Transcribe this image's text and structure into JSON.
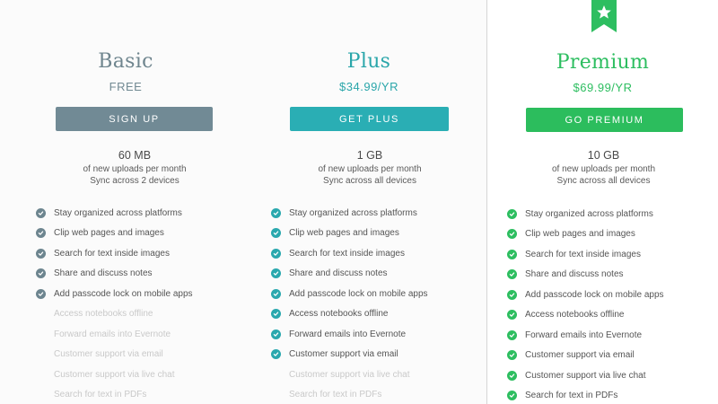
{
  "colors": {
    "basic_accent": "#728a93",
    "basic_button": "#718a95",
    "plus_accent": "#2aa6aa",
    "plus_button": "#2aaeb4",
    "premium_accent": "#2dbe60",
    "premium_button": "#2cbd5d"
  },
  "plans": [
    {
      "name": "Basic",
      "price": "FREE",
      "button_label": "SIGN UP",
      "storage": "60 MB",
      "storage_note": "of new uploads per month",
      "sync": "Sync across 2 devices",
      "features": [
        {
          "label": "Stay organized across platforms",
          "included": true
        },
        {
          "label": "Clip web pages and images",
          "included": true
        },
        {
          "label": "Search for text inside images",
          "included": true
        },
        {
          "label": "Share and discuss notes",
          "included": true
        },
        {
          "label": "Add passcode lock on mobile apps",
          "included": true
        },
        {
          "label": "Access notebooks offline",
          "included": false
        },
        {
          "label": "Forward emails into Evernote",
          "included": false
        },
        {
          "label": "Customer support via email",
          "included": false
        },
        {
          "label": "Customer support via live chat",
          "included": false
        },
        {
          "label": "Search for text in PDFs",
          "included": false
        }
      ]
    },
    {
      "name": "Plus",
      "price": "$34.99/YR",
      "button_label": "GET PLUS",
      "storage": "1 GB",
      "storage_note": "of new uploads per month",
      "sync": "Sync across all devices",
      "features": [
        {
          "label": "Stay organized across platforms",
          "included": true
        },
        {
          "label": "Clip web pages and images",
          "included": true
        },
        {
          "label": "Search for text inside images",
          "included": true
        },
        {
          "label": "Share and discuss notes",
          "included": true
        },
        {
          "label": "Add passcode lock on mobile apps",
          "included": true
        },
        {
          "label": "Access notebooks offline",
          "included": true
        },
        {
          "label": "Forward emails into Evernote",
          "included": true
        },
        {
          "label": "Customer support via email",
          "included": true
        },
        {
          "label": "Customer support via live chat",
          "included": false
        },
        {
          "label": "Search for text in PDFs",
          "included": false
        }
      ]
    },
    {
      "name": "Premium",
      "price": "$69.99/YR",
      "button_label": "GO PREMIUM",
      "storage": "10 GB",
      "storage_note": "of new uploads per month",
      "sync": "Sync across all devices",
      "badge_icon": "star-ribbon-icon",
      "features": [
        {
          "label": "Stay organized across platforms",
          "included": true
        },
        {
          "label": "Clip web pages and images",
          "included": true
        },
        {
          "label": "Search for text inside images",
          "included": true
        },
        {
          "label": "Share and discuss notes",
          "included": true
        },
        {
          "label": "Add passcode lock on mobile apps",
          "included": true
        },
        {
          "label": "Access notebooks offline",
          "included": true
        },
        {
          "label": "Forward emails into Evernote",
          "included": true
        },
        {
          "label": "Customer support via email",
          "included": true
        },
        {
          "label": "Customer support via live chat",
          "included": true
        },
        {
          "label": "Search for text in PDFs",
          "included": true
        }
      ]
    }
  ]
}
